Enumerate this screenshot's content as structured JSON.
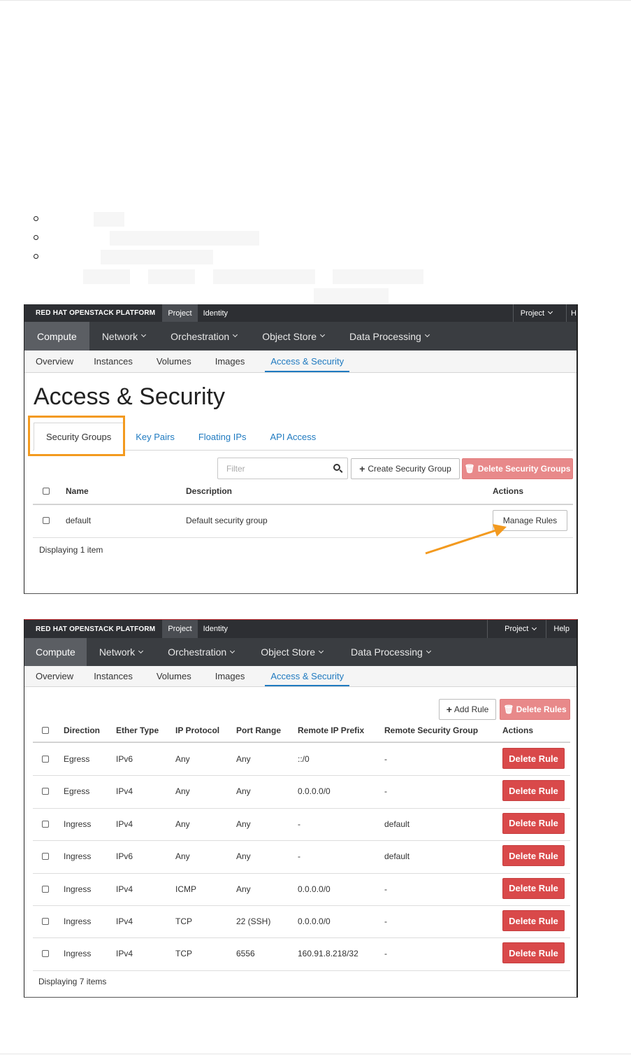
{
  "panel1": {
    "topbar": {
      "brand": "RED HAT OPENSTACK PLATFORM",
      "tabs": [
        "Project",
        "Identity"
      ],
      "right": [
        "Project",
        "H"
      ]
    },
    "nav": [
      "Compute",
      "Network",
      "Orchestration",
      "Object Store",
      "Data Processing"
    ],
    "subnav": [
      "Overview",
      "Instances",
      "Volumes",
      "Images",
      "Access & Security"
    ],
    "title": "Access & Security",
    "tabs": [
      "Security Groups",
      "Key Pairs",
      "Floating IPs",
      "API Access"
    ],
    "filter_placeholder": "Filter",
    "create_button": "Create Security Group",
    "delete_button": "Delete Security Groups",
    "columns": [
      "Name",
      "Description",
      "Actions"
    ],
    "rows": [
      {
        "name": "default",
        "description": "Default security group",
        "action": "Manage Rules"
      }
    ],
    "footer": "Displaying 1 item"
  },
  "panel2": {
    "topbar": {
      "brand": "RED HAT OPENSTACK PLATFORM",
      "tabs": [
        "Project",
        "Identity"
      ],
      "right": [
        "Project",
        "Help"
      ]
    },
    "nav": [
      "Compute",
      "Network",
      "Orchestration",
      "Object Store",
      "Data Processing"
    ],
    "subnav": [
      "Overview",
      "Instances",
      "Volumes",
      "Images",
      "Access & Security"
    ],
    "add_button": "Add Rule",
    "delete_button": "Delete Rules",
    "columns": [
      "Direction",
      "Ether Type",
      "IP Protocol",
      "Port Range",
      "Remote IP Prefix",
      "Remote Security Group",
      "Actions"
    ],
    "rows": [
      [
        "Egress",
        "IPv6",
        "Any",
        "Any",
        "::/0",
        "-",
        "Delete Rule"
      ],
      [
        "Egress",
        "IPv4",
        "Any",
        "Any",
        "0.0.0.0/0",
        "-",
        "Delete Rule"
      ],
      [
        "Ingress",
        "IPv4",
        "Any",
        "Any",
        "-",
        "default",
        "Delete Rule"
      ],
      [
        "Ingress",
        "IPv6",
        "Any",
        "Any",
        "-",
        "default",
        "Delete Rule"
      ],
      [
        "Ingress",
        "IPv4",
        "ICMP",
        "Any",
        "0.0.0.0/0",
        "-",
        "Delete Rule"
      ],
      [
        "Ingress",
        "IPv4",
        "TCP",
        "22 (SSH)",
        "0.0.0.0/0",
        "-",
        "Delete Rule"
      ],
      [
        "Ingress",
        "IPv4",
        "TCP",
        "6556",
        "160.91.8.218/32",
        "-",
        "Delete Rule"
      ]
    ],
    "footer": "Displaying 7 items"
  },
  "colors": {
    "accent_blue": "#1f7ac0",
    "highlight_orange": "#f39a1f",
    "danger_red": "#d9494a",
    "topbar_dark": "#2d2f33"
  }
}
